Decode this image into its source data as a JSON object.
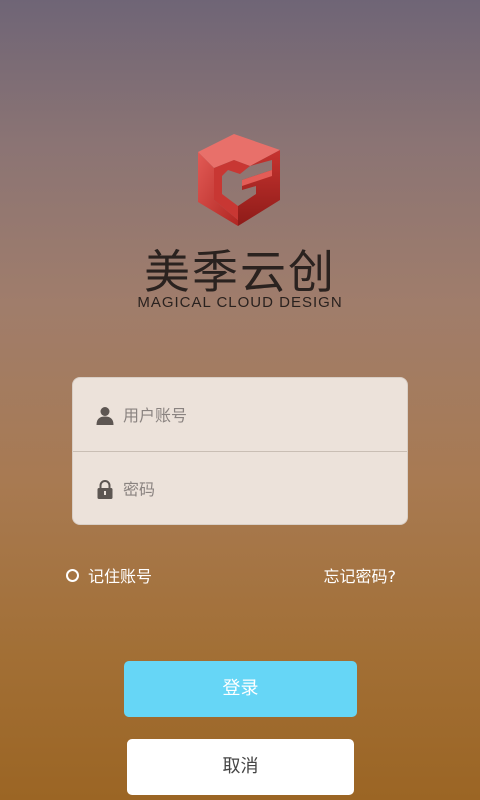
{
  "brand": {
    "name_cn": "美季云创",
    "name_en": "MAGICAL CLOUD DESIGN",
    "logo_icon": "red-g-cube-logo",
    "logo_color": "#d9433f"
  },
  "login_form": {
    "username_placeholder": "用户账号",
    "username_icon": "user-icon",
    "password_placeholder": "密码",
    "password_icon": "lock-icon"
  },
  "options": {
    "remember_label": "记住账号",
    "remember_checked": false,
    "forgot_label": "忘记密码?"
  },
  "buttons": {
    "login_label": "登录",
    "login_color": "#66d6f6",
    "cancel_label": "取消"
  }
}
